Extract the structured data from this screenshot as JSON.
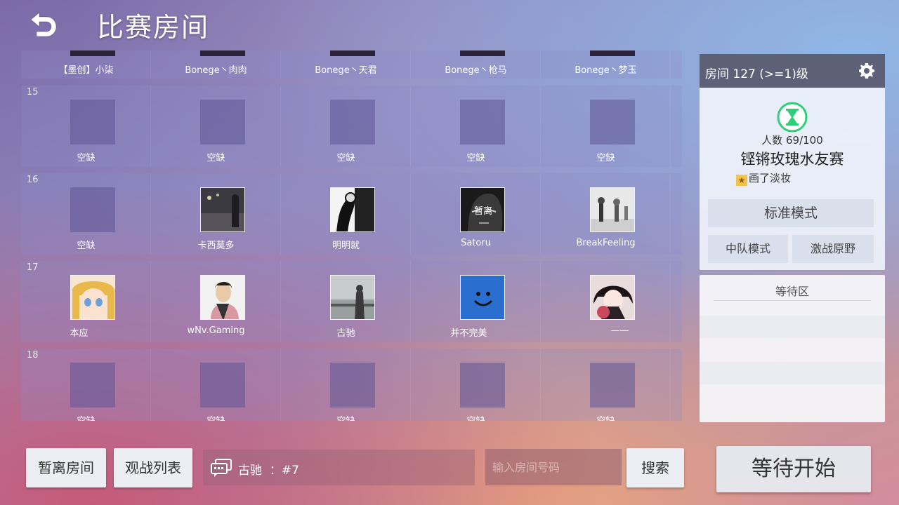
{
  "header": {
    "title": "比赛房间"
  },
  "top_row_names": [
    "【墨创】小柒",
    "Bonege丶肉肉",
    "Bonege丶天君",
    "Bonege丶枪马",
    "Bonege丶梦玉"
  ],
  "rows": [
    {
      "number": "15",
      "slots": [
        {
          "name": "空缺",
          "empty": true
        },
        {
          "name": "空缺",
          "empty": true
        },
        {
          "name": "空缺",
          "empty": true
        },
        {
          "name": "空缺",
          "empty": true
        },
        {
          "name": "空缺",
          "empty": true
        }
      ]
    },
    {
      "number": "16",
      "slots": [
        {
          "name": "空缺",
          "empty": true
        },
        {
          "name": "卡西莫多",
          "empty": false,
          "avatar": "night-street"
        },
        {
          "name": "明明就",
          "empty": false,
          "avatar": "sketch-figure"
        },
        {
          "name": "Satoru",
          "empty": false,
          "avatar": "anime-face-dark",
          "overlay": "暂离"
        },
        {
          "name": "BreakFeeling",
          "empty": false,
          "avatar": "rain-people"
        }
      ]
    },
    {
      "number": "17",
      "slots": [
        {
          "name": "本应",
          "empty": false,
          "avatar": "anime-girl-blonde"
        },
        {
          "name": "wNv.Gaming",
          "empty": false,
          "avatar": "suited-man"
        },
        {
          "name": "古驰",
          "empty": false,
          "avatar": "misty-person"
        },
        {
          "name": "并不完美",
          "empty": false,
          "avatar": "smiley-blue"
        },
        {
          "name": "——",
          "empty": false,
          "avatar": "anime-girl-fan"
        }
      ]
    },
    {
      "number": "18",
      "slots": [
        {
          "name": "空缺",
          "empty": true
        },
        {
          "name": "空缺",
          "empty": true
        },
        {
          "name": "空缺",
          "empty": true
        },
        {
          "name": "空缺",
          "empty": true
        },
        {
          "name": "空缺",
          "empty": true
        }
      ]
    }
  ],
  "room_panel": {
    "room_label": "房间 127 (>=1)级",
    "count": "人数 69/100",
    "room_name": "铿锵玫瑰水友赛",
    "host": "画了淡妆",
    "mode_standard": "标准模式",
    "mode_team": "中队模式",
    "mode_wild": "激战原野"
  },
  "waiting": {
    "title": "等待区"
  },
  "bottom": {
    "away_button": "暂离房间",
    "spectate_button": "观战列表",
    "chat_text": "古驰  ：#7",
    "search_placeholder": "输入房间号码",
    "search_button": "搜索",
    "start_button": "等待开始"
  },
  "colors": {
    "panel_header": "#5c6178",
    "row_bg": "rgba(140,140,200,0.28)",
    "hourglass": "#2fcf7a"
  }
}
